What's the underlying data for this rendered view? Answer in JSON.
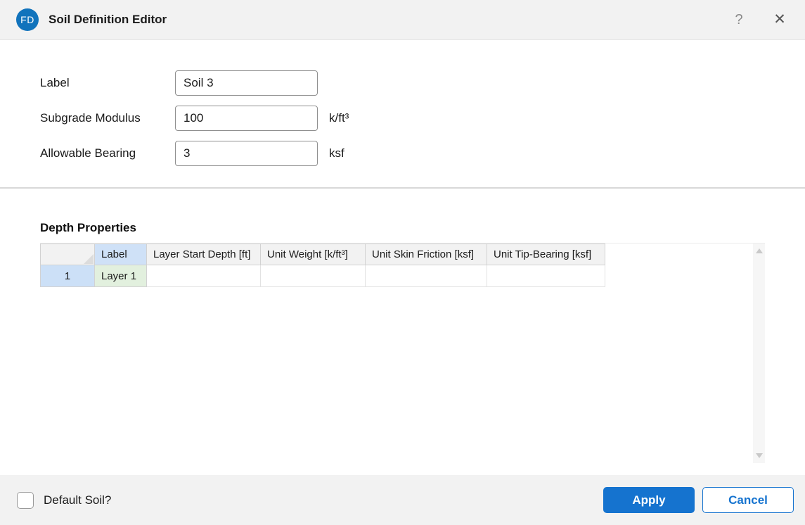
{
  "colors": {
    "accent_blue": "#1573cf",
    "logo_blue": "#1173bc",
    "titlebar_bg": "#f2f2f2",
    "footer_bg": "#f2f2f2",
    "header_cell_blue": "#cfe1f7",
    "row_number_blue": "#cce0f7",
    "label_cell_green": "#e2f0de"
  },
  "titlebar": {
    "logo_text": "FD",
    "title": "Soil Definition Editor",
    "help_glyph": "?",
    "close_glyph": "✕"
  },
  "form": {
    "fields": [
      {
        "label": "Label",
        "value": "Soil 3",
        "unit": ""
      },
      {
        "label": "Subgrade Modulus",
        "value": "100",
        "unit": "k/ft³"
      },
      {
        "label": "Allowable Bearing",
        "value": "3",
        "unit": "ksf"
      }
    ]
  },
  "depth_properties": {
    "section_title": "Depth Properties",
    "columns": [
      "Label",
      "Layer Start Depth [ft]",
      "Unit Weight [k/ft³]",
      "Unit Skin Friction [ksf]",
      "Unit Tip-Bearing [ksf]"
    ],
    "rows": [
      {
        "num": "1",
        "label": "Layer 1",
        "layer_start_depth": "",
        "unit_weight": "",
        "unit_skin_friction": "",
        "unit_tip_bearing": ""
      }
    ]
  },
  "footer": {
    "checkbox_label": "Default Soil?",
    "checkbox_checked": false,
    "apply_label": "Apply",
    "cancel_label": "Cancel"
  }
}
